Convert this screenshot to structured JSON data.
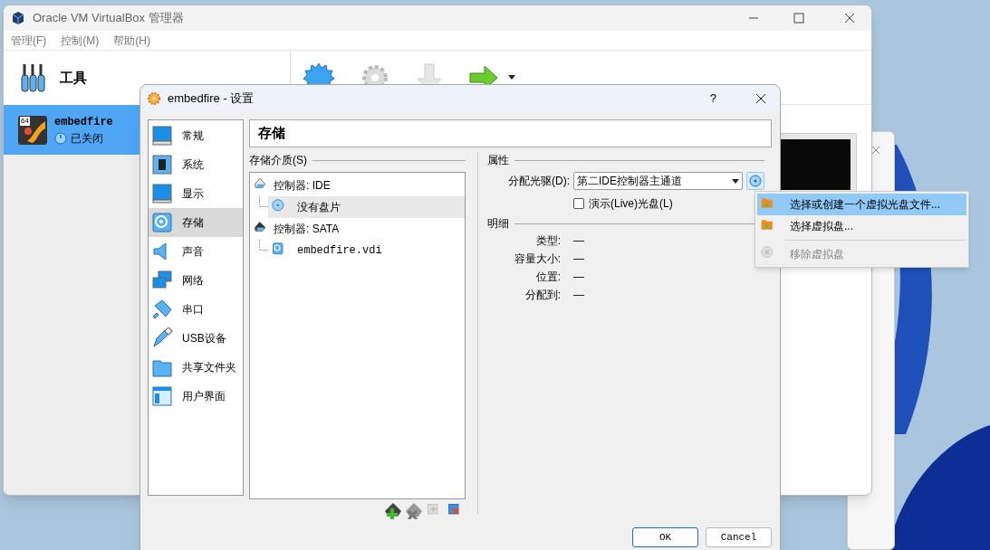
{
  "manager_window": {
    "title": "Oracle VM VirtualBox 管理器",
    "menu": [
      "管理(F)",
      "控制(M)",
      "帮助(H)"
    ],
    "tools_label": "工具",
    "vm": {
      "badge": "64",
      "name": "embedfire",
      "state": "已关闭",
      "selected": true
    }
  },
  "settings_dialog": {
    "title": "embedfire - 设置",
    "help": "?",
    "sections": [
      {
        "label": "常规",
        "selected": false
      },
      {
        "label": "系统",
        "selected": false
      },
      {
        "label": "显示",
        "selected": false
      },
      {
        "label": "存储",
        "selected": true
      },
      {
        "label": "声音",
        "selected": false
      },
      {
        "label": "网络",
        "selected": false
      },
      {
        "label": "串口",
        "selected": false
      },
      {
        "label": "USB设备",
        "selected": false
      },
      {
        "label": "共享文件夹",
        "selected": false
      },
      {
        "label": "用户界面",
        "selected": false
      }
    ],
    "page_title": "存储",
    "storage_label": "存储介质(S)",
    "tree": [
      {
        "label": "控制器: IDE",
        "kind": "ide",
        "selected": false,
        "children": [
          {
            "label": "没有盘片",
            "kind": "optical",
            "selected": true
          }
        ]
      },
      {
        "label": "控制器: SATA",
        "kind": "sata",
        "selected": false,
        "children": [
          {
            "label": "embedfire.vdi",
            "kind": "disk",
            "selected": false
          }
        ]
      }
    ],
    "attributes": {
      "heading": "属性",
      "drive_label": "分配光驱(D):",
      "drive_value": "第二IDE控制器主通道",
      "live_cd": {
        "label": "演示(Live)光盘(L)",
        "checked": false
      }
    },
    "details": {
      "heading": "明细",
      "rows": [
        {
          "label": "类型:",
          "value": "—"
        },
        {
          "label": "容量大小:",
          "value": "—"
        },
        {
          "label": "位置:",
          "value": "—"
        },
        {
          "label": "分配到:",
          "value": "—"
        }
      ]
    },
    "buttons": [
      {
        "label": "OK",
        "default": true
      },
      {
        "label": "Cancel",
        "default": false
      }
    ]
  },
  "popup_menu": [
    {
      "label": "选择或创建一个虚拟光盘文件...",
      "kind": "choose",
      "selected": true,
      "disabled": false
    },
    {
      "label": "选择虚拟盘...",
      "kind": "choose",
      "selected": false,
      "disabled": false
    },
    {
      "label": "移除虚拟盘",
      "kind": "remove",
      "selected": false,
      "disabled": true
    }
  ]
}
